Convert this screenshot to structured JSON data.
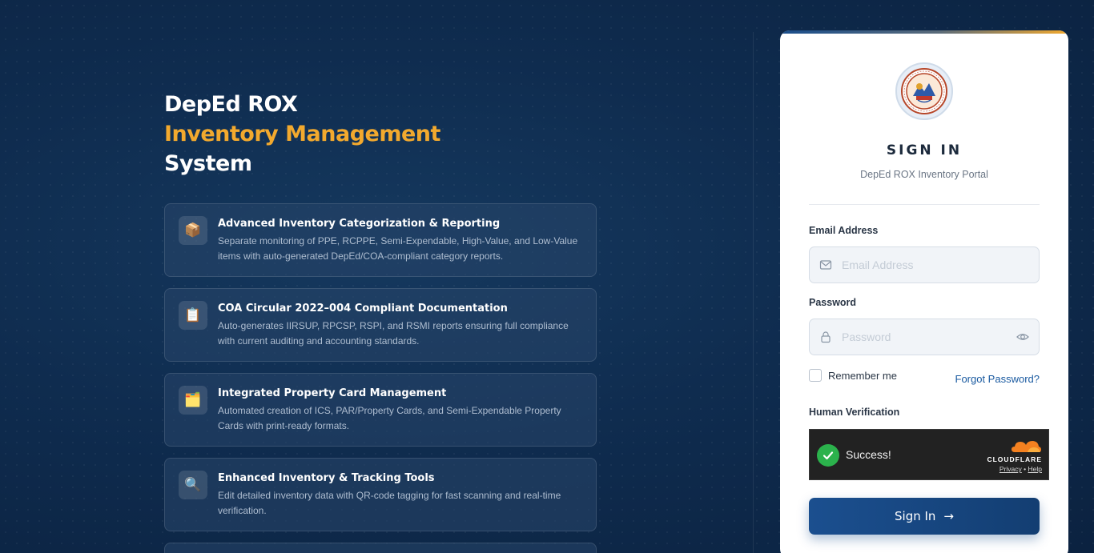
{
  "hero": {
    "line1": "DepEd ROX",
    "line2": "Inventory Management",
    "line3": "System"
  },
  "features": [
    {
      "icon": "package-icon",
      "glyph": "📦",
      "title": "Advanced Inventory Categorization & Reporting",
      "description": "Separate monitoring of PPE, RCPPE, Semi-Expendable, High-Value, and Low-Value items with auto-generated DepEd/COA-compliant category reports."
    },
    {
      "icon": "clipboard-icon",
      "glyph": "📋",
      "title": "COA Circular 2022–004 Compliant Documentation",
      "description": "Auto-generates IIRSUP, RPCSP, RSPI, and RSMI reports ensuring full compliance with current auditing and accounting standards."
    },
    {
      "icon": "card-index-icon",
      "glyph": "🗂️",
      "title": "Integrated Property Card Management",
      "description": "Automated creation of ICS, PAR/Property Cards, and Semi-Expendable Property Cards with print-ready formats."
    },
    {
      "icon": "magnifier-icon",
      "glyph": "🔍",
      "title": "Enhanced Inventory & Tracking Tools",
      "description": "Edit detailed inventory data with QR-code tagging for fast scanning and real-time verification."
    }
  ],
  "login": {
    "title": "SIGN IN",
    "subtitle": "DepEd ROX Inventory Portal",
    "email_label": "Email Address",
    "email_placeholder": "Email Address",
    "email_value": "",
    "password_label": "Password",
    "password_placeholder": "Password",
    "password_value": "",
    "remember_label": "Remember me",
    "forgot_label": "Forgot Password?",
    "verification_label": "Human Verification",
    "signin_label": "Sign In",
    "signin_arrow": "→"
  },
  "captcha": {
    "status": "Success!",
    "brand": "CLOUDFLARE",
    "privacy": "Privacy",
    "separator": "•",
    "help": "Help"
  },
  "colors": {
    "background": "#0d2747",
    "accent": "#f2a92e",
    "primary": "#1b4f8f",
    "success": "#2bb24c"
  }
}
